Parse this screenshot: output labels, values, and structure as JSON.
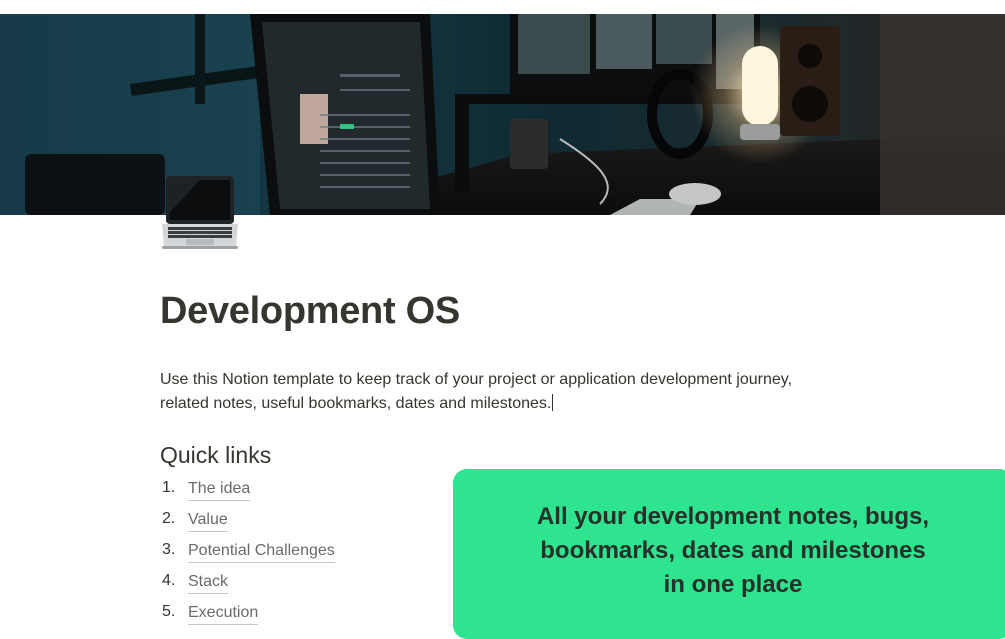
{
  "page": {
    "cover": {
      "description_icon": "desk-setup-cover-image"
    },
    "icon": "laptop-icon",
    "title": "Development OS",
    "description_line1": "Use this Notion template to keep track of your project or application development journey,",
    "description_line2": "related notes, useful bookmarks, dates and milestones."
  },
  "quick_links": {
    "heading": "Quick links",
    "items": [
      {
        "number": "1.",
        "label": "The idea"
      },
      {
        "number": "2.",
        "label": "Value"
      },
      {
        "number": "3.",
        "label": "Potential Challenges"
      },
      {
        "number": "4.",
        "label": "Stack"
      },
      {
        "number": "5.",
        "label": "Execution"
      }
    ]
  },
  "banner": {
    "line1": "All your development notes, bugs,",
    "line2": "bookmarks, dates and milestones",
    "line3": "in one place",
    "color": "#2ee48e"
  },
  "colors": {
    "text": "#37352f",
    "link": "#6b6a66",
    "accent_banner": "#2ee48e"
  }
}
